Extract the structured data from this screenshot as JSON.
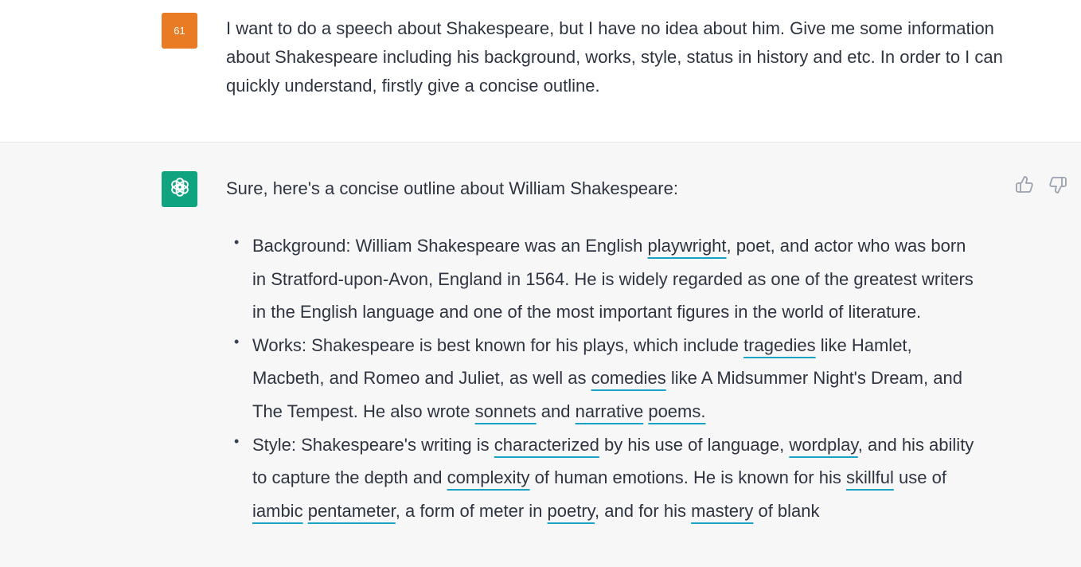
{
  "user_message": {
    "avatar_text": "61",
    "text": "I want to do a speech about Shakespeare, but I have no idea about him. Give me some information about Shakespeare including his background, works, style, status in history and etc. In order to I can quickly understand, firstly give a concise outline."
  },
  "assistant_message": {
    "intro": "Sure, here's a concise outline about William Shakespeare:",
    "bullets": [
      {
        "segments": [
          {
            "text": "Background: William Shakespeare was an English ",
            "link": false
          },
          {
            "text": "playwright",
            "link": true
          },
          {
            "text": ", poet, and actor who was born in Stratford-upon-Avon, England in 1564. He is widely regarded as one of the greatest writers in the English language and one of the most important figures in the world of literature.",
            "link": false
          }
        ]
      },
      {
        "segments": [
          {
            "text": "Works: Shakespeare is best known for his plays, which include ",
            "link": false
          },
          {
            "text": "tragedies",
            "link": true
          },
          {
            "text": " like Hamlet, Macbeth, and Romeo and Juliet, as well as ",
            "link": false
          },
          {
            "text": "comedies",
            "link": true
          },
          {
            "text": " like A Midsummer Night's Dream, and The Tempest. He also wrote ",
            "link": false
          },
          {
            "text": "sonnets",
            "link": true
          },
          {
            "text": " and ",
            "link": false
          },
          {
            "text": "narrative",
            "link": true
          },
          {
            "text": " ",
            "link": false
          },
          {
            "text": "poems.",
            "link": true
          }
        ]
      },
      {
        "segments": [
          {
            "text": "Style: Shakespeare's writing is ",
            "link": false
          },
          {
            "text": "characterized",
            "link": true
          },
          {
            "text": " by his use of language, ",
            "link": false
          },
          {
            "text": "wordplay",
            "link": true
          },
          {
            "text": ", and his ability to capture the depth and ",
            "link": false
          },
          {
            "text": "complexity",
            "link": true
          },
          {
            "text": " of human emotions. He is known for his ",
            "link": false
          },
          {
            "text": "skillful",
            "link": true
          },
          {
            "text": " use of ",
            "link": false
          },
          {
            "text": "iambic",
            "link": true
          },
          {
            "text": " ",
            "link": false
          },
          {
            "text": "pentameter",
            "link": true
          },
          {
            "text": ", a form of meter in ",
            "link": false
          },
          {
            "text": "poetry",
            "link": true
          },
          {
            "text": ", and for his ",
            "link": false
          },
          {
            "text": "mastery",
            "link": true
          },
          {
            "text": " of blank",
            "link": false
          }
        ]
      }
    ]
  },
  "icons": {
    "assistant_avatar": "openai-logo-icon",
    "thumbs_up": "thumbs-up-icon",
    "thumbs_down": "thumbs-down-icon"
  },
  "colors": {
    "user_avatar_bg": "#e97b25",
    "assistant_avatar_bg": "#10a37f",
    "assistant_row_bg": "#f7f7f8",
    "link_underline": "#19a2c4"
  }
}
